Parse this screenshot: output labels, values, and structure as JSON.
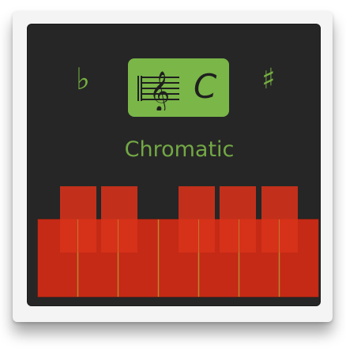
{
  "key_selector": {
    "flat_symbol": "♭",
    "sharp_symbol": "♯",
    "key_name": "C",
    "clef_icon": "treble-clef-icon",
    "accent_color": "#7ab648",
    "mode_label": "Chromatic"
  },
  "keyboard": {
    "white_key_count": 7,
    "black_key_count": 5,
    "key_color": "#cf2a16"
  }
}
